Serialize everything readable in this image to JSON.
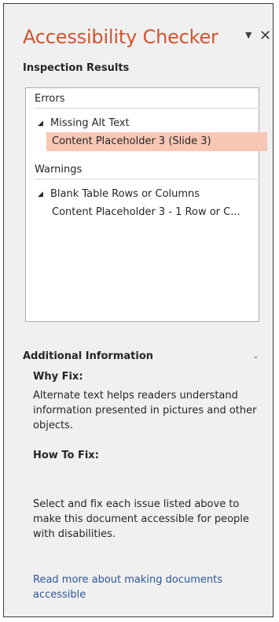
{
  "pane": {
    "title": "Accessibility Checker",
    "title_color": "#d35230",
    "dropdown_glyph": "▼",
    "close_glyph": "✕",
    "subheading": "Inspection Results"
  },
  "results": {
    "errors_label": "Errors",
    "errors_group": {
      "expand_glyph": "◢",
      "label": "Missing Alt Text",
      "items": [
        "Content Placeholder 3  (Slide 3)"
      ]
    },
    "warnings_label": "Warnings",
    "warnings_group": {
      "expand_glyph": "◢",
      "label": "Blank Table Rows or Columns",
      "items": [
        "Content Placeholder 3 - 1 Row or C..."
      ]
    },
    "selected_color": "#f8c7b3"
  },
  "additional": {
    "heading": "Additional Information",
    "collapse_glyph": "⌄",
    "why_fix_label": "Why Fix:",
    "why_fix_text": "Alternate text helps readers understand information presented in pictures and other objects.",
    "how_to_fix_label": "How To Fix:",
    "how_to_fix_text": "Select and fix each issue listed above to make this document accessible for people with disabilities.",
    "link_text": "Read more about making documents accessible",
    "link_color": "#2b579a"
  }
}
